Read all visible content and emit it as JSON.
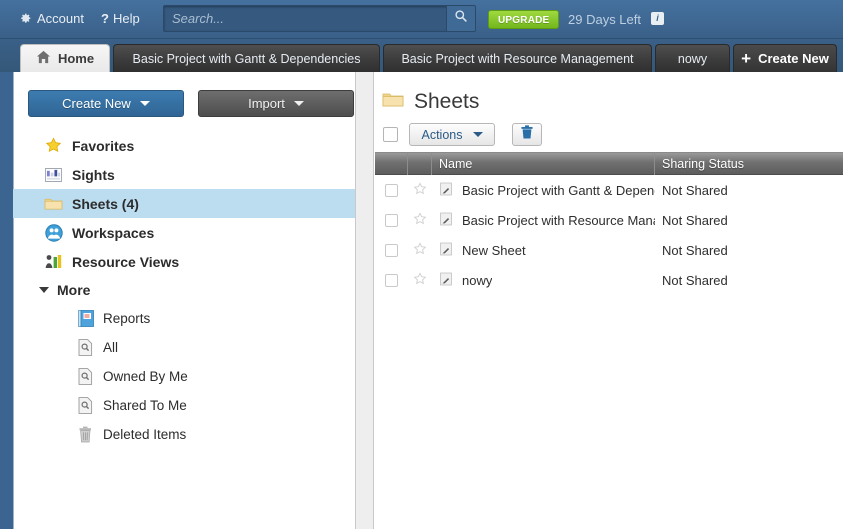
{
  "topbar": {
    "account_label": "Account",
    "help_label": "Help",
    "gear_icon": "gear-icon",
    "help_icon": "question-mark-icon",
    "search_placeholder": "Search...",
    "search_value": "",
    "search_icon": "search-icon",
    "upgrade_label": "UPGRADE",
    "days_left_label": "29 Days Left",
    "info_icon_label": "i",
    "colors": {
      "bar_bg": "#3b6490",
      "upgrade_green": "#8ccd2e",
      "accent_blue": "#3d7cb0"
    }
  },
  "tabs": [
    {
      "label": "Home",
      "icon": "home-icon",
      "active": true
    },
    {
      "label": "Basic Project with Gantt & Dependencies",
      "active": false
    },
    {
      "label": "Basic Project with Resource Management",
      "active": false
    },
    {
      "label": "nowy",
      "active": false
    },
    {
      "label": "Create New",
      "icon": "plus-icon",
      "active": false
    }
  ],
  "sidebar": {
    "create_new_label": "Create New",
    "import_label": "Import",
    "items": [
      {
        "label": "Favorites",
        "icon": "star-icon",
        "selected": false
      },
      {
        "label": "Sights",
        "icon": "sights-grid-icon",
        "selected": false
      },
      {
        "label": "Sheets (4)",
        "icon": "folder-icon",
        "selected": true
      },
      {
        "label": "Workspaces",
        "icon": "people-icon",
        "selected": false
      },
      {
        "label": "Resource Views",
        "icon": "resource-bars-icon",
        "selected": false
      }
    ],
    "more_label": "More",
    "more_expanded": true,
    "sub_items": [
      {
        "label": "Reports",
        "icon": "report-book-icon"
      },
      {
        "label": "All",
        "icon": "search-doc-icon"
      },
      {
        "label": "Owned By Me",
        "icon": "search-doc-icon"
      },
      {
        "label": "Shared To Me",
        "icon": "search-doc-icon"
      },
      {
        "label": "Deleted Items",
        "icon": "trash-icon"
      }
    ]
  },
  "main": {
    "title": "Sheets",
    "title_icon": "folder-icon",
    "toolbar": {
      "select_all_checkbox": false,
      "actions_label": "Actions",
      "delete_icon": "trash-icon"
    },
    "table": {
      "columns": [
        "",
        "",
        "Name",
        "Sharing Status"
      ],
      "rows": [
        {
          "checked": false,
          "favorite": false,
          "icon": "sheet-icon",
          "name": "Basic Project with Gantt & Dependencies",
          "sharing_status": "Not Shared"
        },
        {
          "checked": false,
          "favorite": false,
          "icon": "sheet-icon",
          "name": "Basic Project with Resource Management",
          "sharing_status": "Not Shared"
        },
        {
          "checked": false,
          "favorite": false,
          "icon": "sheet-icon",
          "name": "New Sheet",
          "sharing_status": "Not Shared"
        },
        {
          "checked": false,
          "favorite": false,
          "icon": "sheet-icon",
          "name": "nowy",
          "sharing_status": "Not Shared"
        }
      ]
    }
  }
}
